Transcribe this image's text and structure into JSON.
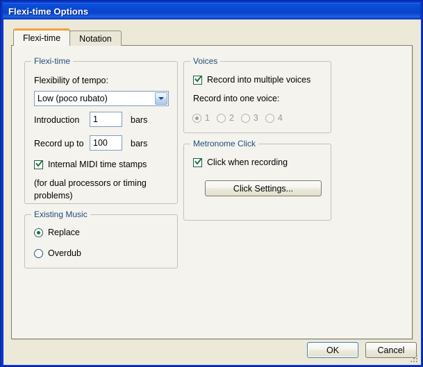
{
  "window": {
    "title": "Flexi-time Options"
  },
  "tabs": [
    {
      "label": "Flexi-time",
      "active": true
    },
    {
      "label": "Notation",
      "active": false
    }
  ],
  "groups": {
    "flexitime": {
      "legend": "Flexi-time",
      "tempo_label": "Flexibility of tempo:",
      "tempo_value": "Low (poco rubato)",
      "tempo_options": [
        "Low (poco rubato)"
      ],
      "introduction_label": "Introduction",
      "introduction_value": "1",
      "introduction_units": "bars",
      "record_up_to_label": "Record up to",
      "record_up_to_value": "100",
      "record_up_to_units": "bars",
      "midi_stamps_label": "Internal MIDI time stamps",
      "midi_stamps_checked": true,
      "midi_note_line1": "(for dual processors or timing",
      "midi_note_line2": "problems)"
    },
    "existing_music": {
      "legend": "Existing Music",
      "options": [
        {
          "label": "Replace",
          "selected": true
        },
        {
          "label": "Overdub",
          "selected": false
        }
      ]
    },
    "voices": {
      "legend": "Voices",
      "multiple_voices_label": "Record into multiple voices",
      "multiple_voices_checked": true,
      "one_voice_label": "Record into one voice:",
      "one_voice_disabled": true,
      "voice_options": [
        {
          "label": "1",
          "selected": true
        },
        {
          "label": "2",
          "selected": false
        },
        {
          "label": "3",
          "selected": false
        },
        {
          "label": "4",
          "selected": false
        }
      ]
    },
    "metronome": {
      "legend": "Metronome Click",
      "click_when_recording_label": "Click when recording",
      "click_when_recording_checked": true,
      "click_settings_label": "Click Settings..."
    }
  },
  "footer": {
    "ok_label": "OK",
    "cancel_label": "Cancel"
  },
  "colors": {
    "title_bar": "#0a46d0",
    "legend_text": "#1f4e79",
    "active_tab_accent": "#f2a13a",
    "check_green": "#137a23",
    "dialog_bg": "#ece9d8",
    "page_bg": "#f4f3ee"
  }
}
